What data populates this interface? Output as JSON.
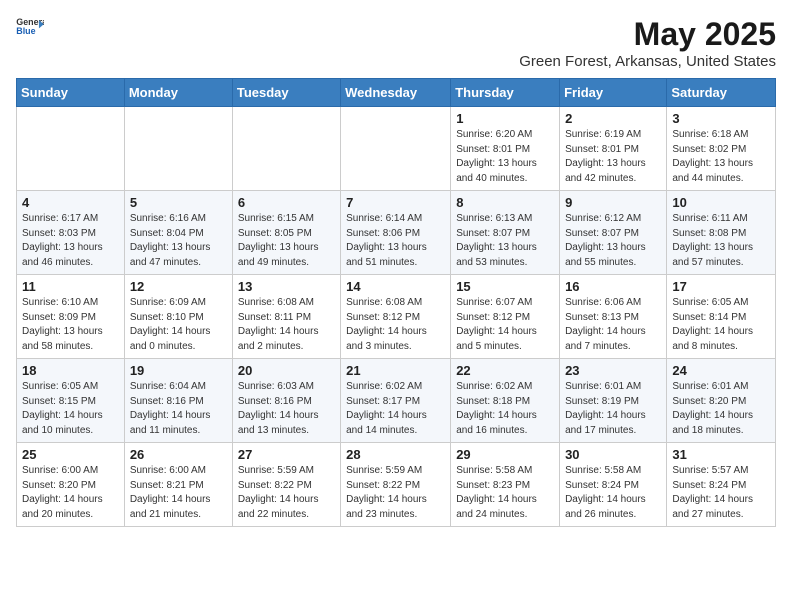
{
  "header": {
    "logo_line1": "General",
    "logo_line2": "Blue",
    "title": "May 2025",
    "subtitle": "Green Forest, Arkansas, United States"
  },
  "weekdays": [
    "Sunday",
    "Monday",
    "Tuesday",
    "Wednesday",
    "Thursday",
    "Friday",
    "Saturday"
  ],
  "weeks": [
    [
      {
        "day": "",
        "info": ""
      },
      {
        "day": "",
        "info": ""
      },
      {
        "day": "",
        "info": ""
      },
      {
        "day": "",
        "info": ""
      },
      {
        "day": "1",
        "info": "Sunrise: 6:20 AM\nSunset: 8:01 PM\nDaylight: 13 hours\nand 40 minutes."
      },
      {
        "day": "2",
        "info": "Sunrise: 6:19 AM\nSunset: 8:01 PM\nDaylight: 13 hours\nand 42 minutes."
      },
      {
        "day": "3",
        "info": "Sunrise: 6:18 AM\nSunset: 8:02 PM\nDaylight: 13 hours\nand 44 minutes."
      }
    ],
    [
      {
        "day": "4",
        "info": "Sunrise: 6:17 AM\nSunset: 8:03 PM\nDaylight: 13 hours\nand 46 minutes."
      },
      {
        "day": "5",
        "info": "Sunrise: 6:16 AM\nSunset: 8:04 PM\nDaylight: 13 hours\nand 47 minutes."
      },
      {
        "day": "6",
        "info": "Sunrise: 6:15 AM\nSunset: 8:05 PM\nDaylight: 13 hours\nand 49 minutes."
      },
      {
        "day": "7",
        "info": "Sunrise: 6:14 AM\nSunset: 8:06 PM\nDaylight: 13 hours\nand 51 minutes."
      },
      {
        "day": "8",
        "info": "Sunrise: 6:13 AM\nSunset: 8:07 PM\nDaylight: 13 hours\nand 53 minutes."
      },
      {
        "day": "9",
        "info": "Sunrise: 6:12 AM\nSunset: 8:07 PM\nDaylight: 13 hours\nand 55 minutes."
      },
      {
        "day": "10",
        "info": "Sunrise: 6:11 AM\nSunset: 8:08 PM\nDaylight: 13 hours\nand 57 minutes."
      }
    ],
    [
      {
        "day": "11",
        "info": "Sunrise: 6:10 AM\nSunset: 8:09 PM\nDaylight: 13 hours\nand 58 minutes."
      },
      {
        "day": "12",
        "info": "Sunrise: 6:09 AM\nSunset: 8:10 PM\nDaylight: 14 hours\nand 0 minutes."
      },
      {
        "day": "13",
        "info": "Sunrise: 6:08 AM\nSunset: 8:11 PM\nDaylight: 14 hours\nand 2 minutes."
      },
      {
        "day": "14",
        "info": "Sunrise: 6:08 AM\nSunset: 8:12 PM\nDaylight: 14 hours\nand 3 minutes."
      },
      {
        "day": "15",
        "info": "Sunrise: 6:07 AM\nSunset: 8:12 PM\nDaylight: 14 hours\nand 5 minutes."
      },
      {
        "day": "16",
        "info": "Sunrise: 6:06 AM\nSunset: 8:13 PM\nDaylight: 14 hours\nand 7 minutes."
      },
      {
        "day": "17",
        "info": "Sunrise: 6:05 AM\nSunset: 8:14 PM\nDaylight: 14 hours\nand 8 minutes."
      }
    ],
    [
      {
        "day": "18",
        "info": "Sunrise: 6:05 AM\nSunset: 8:15 PM\nDaylight: 14 hours\nand 10 minutes."
      },
      {
        "day": "19",
        "info": "Sunrise: 6:04 AM\nSunset: 8:16 PM\nDaylight: 14 hours\nand 11 minutes."
      },
      {
        "day": "20",
        "info": "Sunrise: 6:03 AM\nSunset: 8:16 PM\nDaylight: 14 hours\nand 13 minutes."
      },
      {
        "day": "21",
        "info": "Sunrise: 6:02 AM\nSunset: 8:17 PM\nDaylight: 14 hours\nand 14 minutes."
      },
      {
        "day": "22",
        "info": "Sunrise: 6:02 AM\nSunset: 8:18 PM\nDaylight: 14 hours\nand 16 minutes."
      },
      {
        "day": "23",
        "info": "Sunrise: 6:01 AM\nSunset: 8:19 PM\nDaylight: 14 hours\nand 17 minutes."
      },
      {
        "day": "24",
        "info": "Sunrise: 6:01 AM\nSunset: 8:20 PM\nDaylight: 14 hours\nand 18 minutes."
      }
    ],
    [
      {
        "day": "25",
        "info": "Sunrise: 6:00 AM\nSunset: 8:20 PM\nDaylight: 14 hours\nand 20 minutes."
      },
      {
        "day": "26",
        "info": "Sunrise: 6:00 AM\nSunset: 8:21 PM\nDaylight: 14 hours\nand 21 minutes."
      },
      {
        "day": "27",
        "info": "Sunrise: 5:59 AM\nSunset: 8:22 PM\nDaylight: 14 hours\nand 22 minutes."
      },
      {
        "day": "28",
        "info": "Sunrise: 5:59 AM\nSunset: 8:22 PM\nDaylight: 14 hours\nand 23 minutes."
      },
      {
        "day": "29",
        "info": "Sunrise: 5:58 AM\nSunset: 8:23 PM\nDaylight: 14 hours\nand 24 minutes."
      },
      {
        "day": "30",
        "info": "Sunrise: 5:58 AM\nSunset: 8:24 PM\nDaylight: 14 hours\nand 26 minutes."
      },
      {
        "day": "31",
        "info": "Sunrise: 5:57 AM\nSunset: 8:24 PM\nDaylight: 14 hours\nand 27 minutes."
      }
    ]
  ]
}
